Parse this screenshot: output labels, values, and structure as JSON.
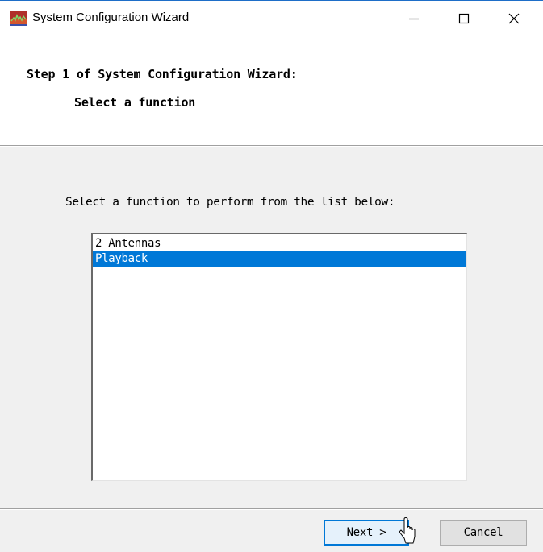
{
  "window": {
    "title": "System Configuration Wizard"
  },
  "titlebar": {
    "minimize_icon": "minimize-icon",
    "maximize_icon": "maximize-icon",
    "close_icon": "close-icon"
  },
  "header": {
    "step_title": "Step 1 of System Configuration Wizard:",
    "step_subtitle": "Select a function"
  },
  "content": {
    "prompt": "Select a function to perform from the list below:",
    "list": {
      "items": [
        {
          "label": "2 Antennas",
          "selected": false
        },
        {
          "label": "Playback",
          "selected": true
        }
      ]
    }
  },
  "footer": {
    "next_label": "Next >",
    "cancel_label": "Cancel"
  },
  "colors": {
    "selection": "#0078d7",
    "window_bg": "#f0f0f0",
    "header_bg": "#ffffff"
  }
}
